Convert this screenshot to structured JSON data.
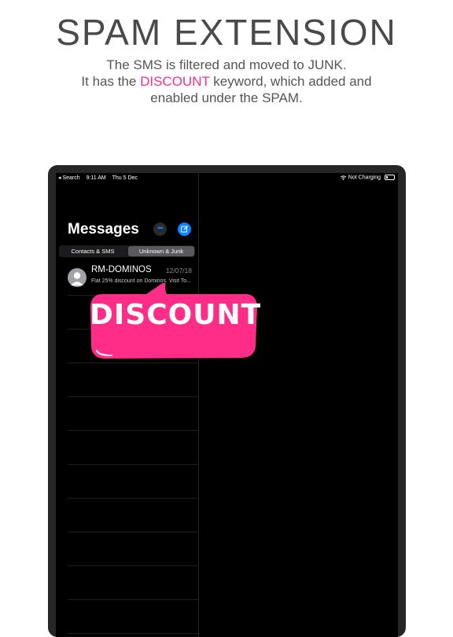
{
  "header": {
    "title": "SPAM EXTENSION",
    "line1": "The SMS is filtered and moved to JUNK.",
    "line2_prefix": "It has the",
    "line2_keyword": "DISCOUNT",
    "line2_suffix": "keyword, which added and",
    "line3": "enabled under the SPAM."
  },
  "statusbar": {
    "back": "◂ Search",
    "time": "9:11 AM",
    "date": "Thu 5 Dec",
    "battery_text": "Not Charging"
  },
  "messages": {
    "title": "Messages",
    "tabs": [
      "Contacts & SMS",
      "Unknown & Junk"
    ],
    "active_tab": "Unknown & Junk",
    "items": [
      {
        "sender": "RM-DOMINOS",
        "date": "12/07/18",
        "preview": "Flat 25% discount on Dominos. Visit To..."
      }
    ]
  },
  "callout": {
    "text": "DISCOUNT"
  },
  "colors": {
    "accent": "#ff2d87",
    "ios_blue": "#0a84ff"
  },
  "icons": [
    "wifi-icon",
    "battery-icon",
    "more-icon",
    "compose-icon",
    "avatar-icon"
  ]
}
